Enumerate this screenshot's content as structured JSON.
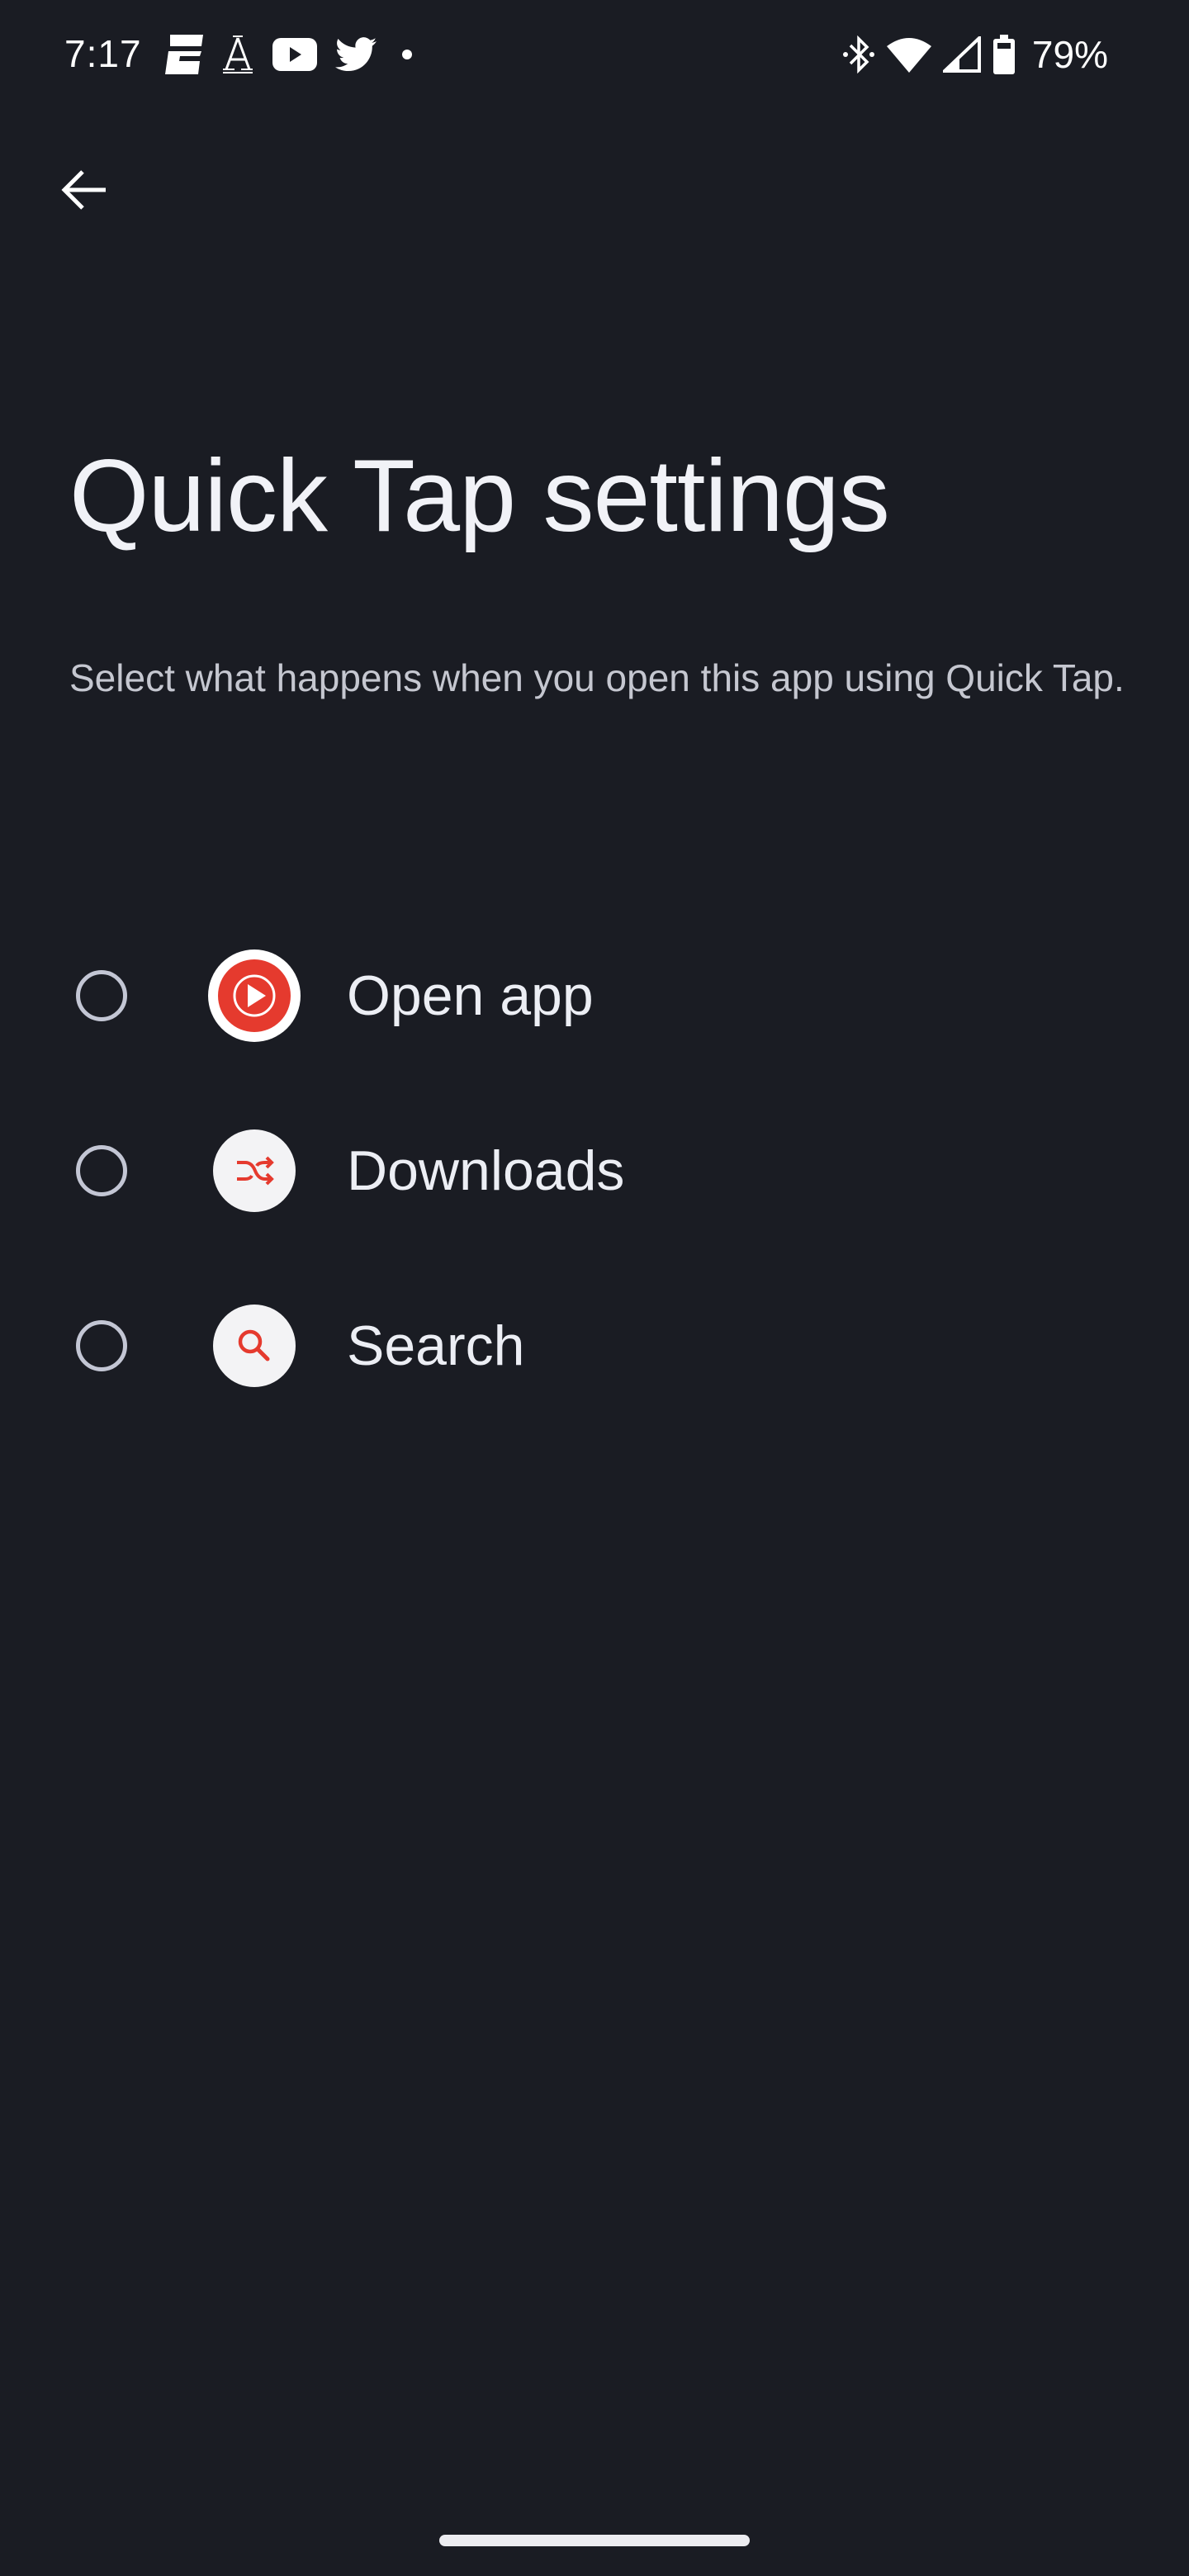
{
  "status_bar": {
    "time": "7:17",
    "notification_icons": [
      "espn-icon",
      "news-a-icon",
      "youtube-icon",
      "twitter-icon",
      "more-dot-icon"
    ],
    "system_icons": [
      "bluetooth-icon",
      "wifi-icon",
      "cell-signal-icon",
      "battery-icon"
    ],
    "battery_percent": "79%"
  },
  "header": {
    "back_icon": "arrow-back-icon",
    "title": "Quick Tap settings",
    "description": "Select what happens when you open this app using Quick Tap."
  },
  "options": [
    {
      "label": "Open app",
      "icon": "youtube-music-icon",
      "selected": false
    },
    {
      "label": "Downloads",
      "icon": "shuffle-icon",
      "selected": false
    },
    {
      "label": "Search",
      "icon": "search-icon",
      "selected": false
    }
  ],
  "colors": {
    "background": "#1a1c23",
    "accent_red": "#e53a2e",
    "radio_outline": "#c3c6d4"
  }
}
